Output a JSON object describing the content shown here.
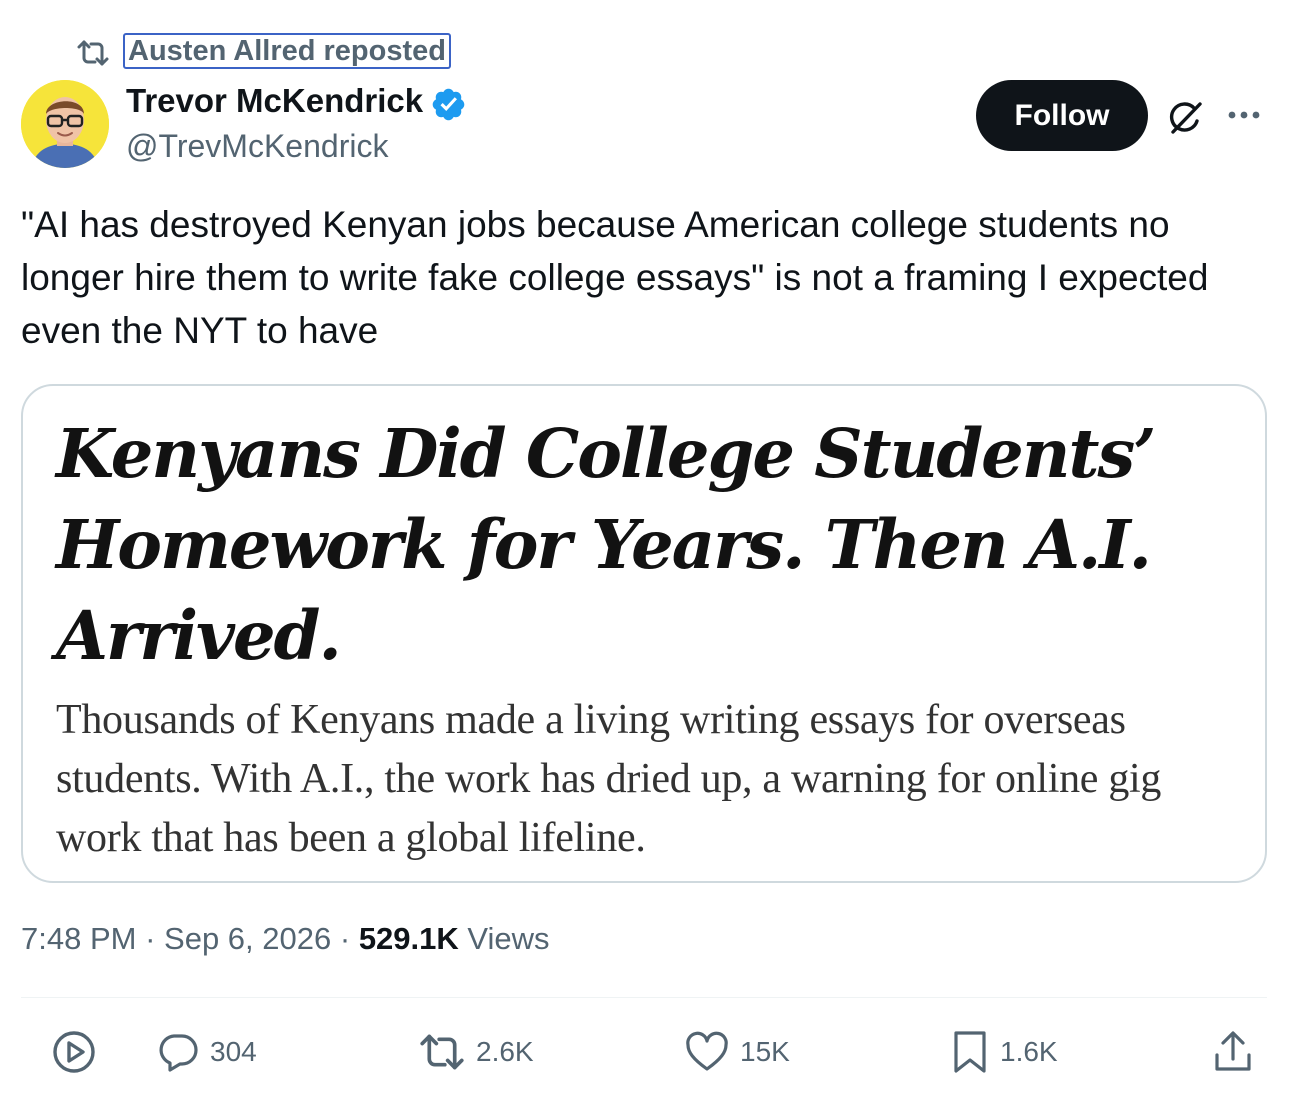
{
  "repost": {
    "label": "Austen Allred reposted",
    "icon": "repost-icon"
  },
  "author": {
    "display_name": "Trevor McKendrick",
    "handle": "@TrevMcKendrick",
    "verified": true,
    "avatar": "avatar"
  },
  "header_actions": {
    "follow_label": "Follow",
    "grok_icon": "grok-icon",
    "more_icon": "more-icon"
  },
  "tweet": {
    "text": "\"AI has destroyed Kenyan jobs because American college students no longer hire them to write fake college essays\" is not a framing I expected even the NYT to have"
  },
  "card": {
    "headline": "Kenyans Did College Students’ Homework for Years. Then A.I. Arrived.",
    "summary": "Thousands of Kenyans made a living writing essays for overseas students. With A.I., the work has dried up, a warning for online gig work that has been a global lifeline."
  },
  "meta": {
    "time": "7:48 PM",
    "date": "Sep 6, 2026",
    "separator": "·",
    "views_count": "529.1K",
    "views_label": "Views"
  },
  "actions": {
    "play_icon": "play-icon",
    "replies": "304",
    "reposts": "2.6K",
    "likes": "15K",
    "bookmarks": "1.6K",
    "share_icon": "share-icon"
  },
  "colors": {
    "text": "#0f1419",
    "secondary": "#536471",
    "verified": "#1d9bf0",
    "follow_bg": "#0f1419",
    "card_border": "#cfd9de",
    "avatar_bg": "#f6e43a"
  }
}
